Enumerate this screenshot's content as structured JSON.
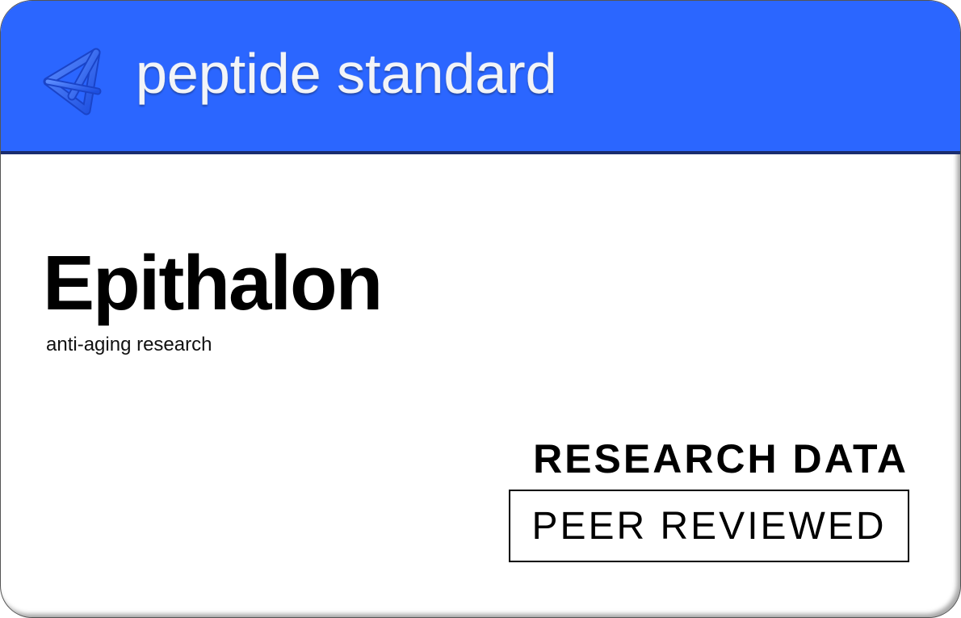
{
  "brand": {
    "name": "peptide standard",
    "logo_icon": "triangular-knot-icon",
    "header_color": "#2b66ff"
  },
  "product": {
    "name": "Epithalon",
    "subtitle": "anti-aging research"
  },
  "badges": {
    "research_label": "RESEARCH DATA",
    "review_label": "PEER REVIEWED"
  }
}
